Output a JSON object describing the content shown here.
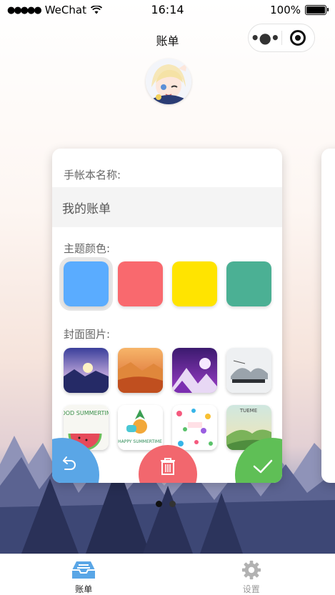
{
  "status_bar": {
    "carrier": "WeChat",
    "time": "16:14",
    "battery": "100%"
  },
  "nav": {
    "title": "账单",
    "more_icon": "more-dots-icon",
    "close_icon": "target-icon"
  },
  "form": {
    "name_label": "手帐本名称:",
    "name_value": "我的账单",
    "theme_label": "主题颜色:",
    "cover_label": "封面图片:"
  },
  "theme_colors": [
    "#5aacff",
    "#f9696e",
    "#ffe400",
    "#4bb094"
  ],
  "selected_color": "#5aacff",
  "covers": [
    {
      "text": ""
    },
    {
      "text": ""
    },
    {
      "text": ""
    },
    {
      "text": ""
    },
    {
      "text": "GOOD SUMMERTIME"
    },
    {
      "text": "HAPPY SUMMERTIME"
    },
    {
      "text": ""
    },
    {
      "text": "TUEME"
    }
  ],
  "actions": {
    "back_icon": "undo-arrow-icon",
    "delete_icon": "trash-icon",
    "confirm_icon": "check-icon"
  },
  "pager": {
    "count": 2,
    "active": 0
  },
  "tab_bar": {
    "items": [
      {
        "label": "账单",
        "icon": "inbox-icon",
        "active": true
      },
      {
        "label": "设置",
        "icon": "gear-icon",
        "active": false
      }
    ]
  }
}
